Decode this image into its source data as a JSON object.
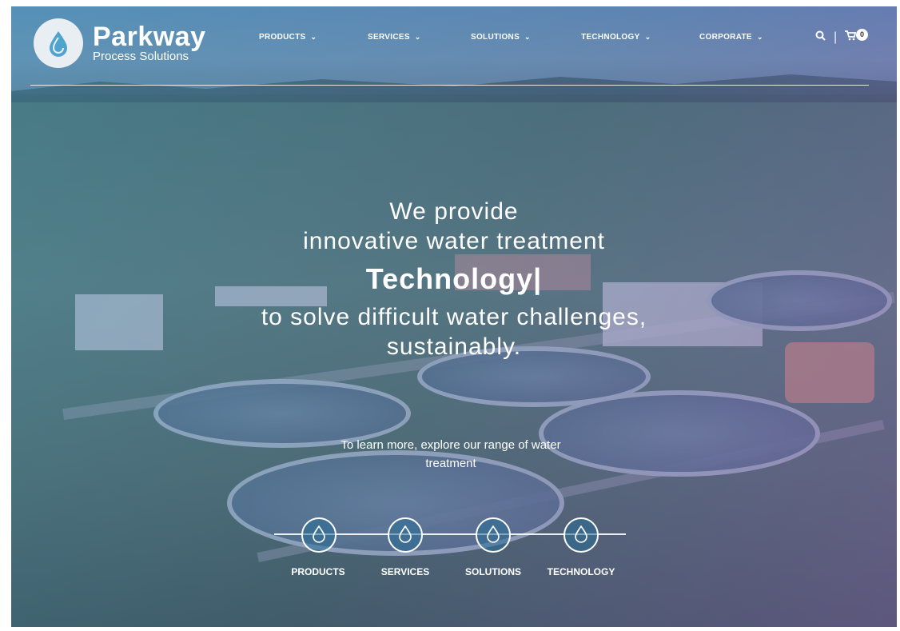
{
  "brand": {
    "name": "Parkway",
    "subtitle": "Process Solutions"
  },
  "nav": {
    "items": [
      {
        "label": "PRODUCTS"
      },
      {
        "label": "SERVICES"
      },
      {
        "label": "SOLUTIONS"
      },
      {
        "label": "TECHNOLOGY"
      },
      {
        "label": "CORPORATE"
      }
    ]
  },
  "cart": {
    "count": "0"
  },
  "hero": {
    "line1": "We provide",
    "line2": "innovative water treatment",
    "line3": "Technology|",
    "line4": "to solve difficult water challenges,",
    "line5": "sustainably.",
    "learn_more": "To learn more, explore our range of water treatment"
  },
  "explore": {
    "items": [
      {
        "label": "PRODUCTS",
        "icon": "water-drop-icon"
      },
      {
        "label": "SERVICES",
        "icon": "water-drop-icon"
      },
      {
        "label": "SOLUTIONS",
        "icon": "water-drop-icon"
      },
      {
        "label": "TECHNOLOGY",
        "icon": "water-drop-icon"
      }
    ]
  },
  "colors": {
    "overlay_start": "#3c8cb4",
    "overlay_end": "#8250aa",
    "text": "#ffffff"
  }
}
